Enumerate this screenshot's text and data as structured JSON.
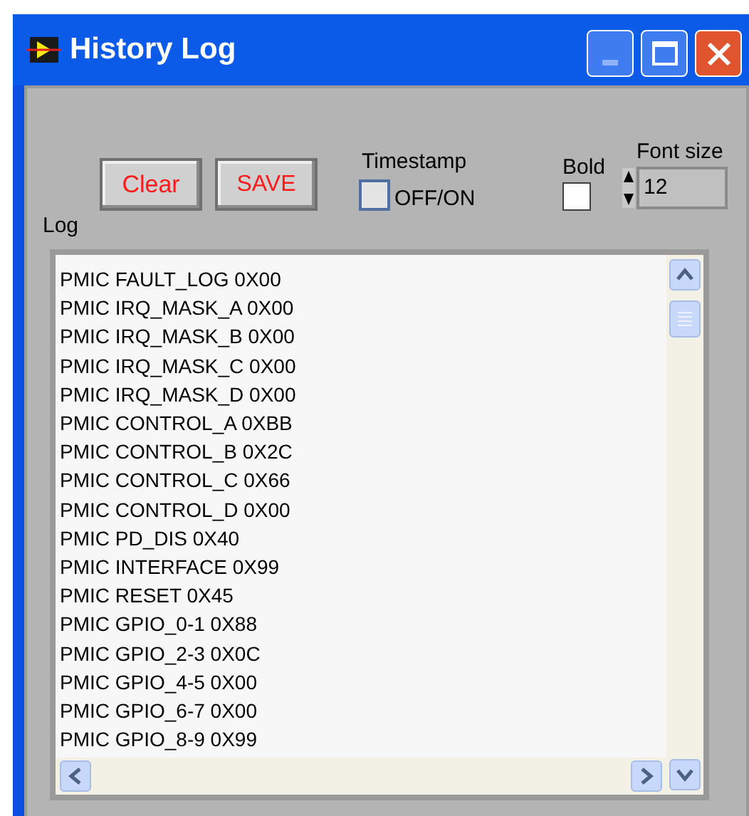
{
  "window": {
    "title": "History Log"
  },
  "buttons": [
    {
      "label": "Clear"
    },
    {
      "label": "SAVE"
    }
  ],
  "timestamp": {
    "label": "Timestamp",
    "option": "OFF/ON",
    "checked": false
  },
  "bold": {
    "label": "Bold",
    "checked": false
  },
  "font_size": {
    "label": "Font size",
    "value": "12"
  },
  "log": {
    "label": "Log",
    "lines": [
      "PMIC FAULT_LOG 0X00",
      "PMIC IRQ_MASK_A 0X00",
      "PMIC IRQ_MASK_B 0X00",
      "PMIC IRQ_MASK_C 0X00",
      "PMIC IRQ_MASK_D 0X00",
      "PMIC CONTROL_A 0XBB",
      "PMIC CONTROL_B 0X2C",
      "PMIC CONTROL_C 0X66",
      "PMIC CONTROL_D 0X00",
      "PMIC PD_DIS 0X40",
      "PMIC INTERFACE 0X99",
      "PMIC RESET 0X45",
      "PMIC GPIO_0-1 0X88",
      "PMIC GPIO_2-3 0X0C",
      "PMIC GPIO_4-5 0X00",
      "PMIC GPIO_6-7 0X00",
      "PMIC GPIO_8-9 0X99"
    ]
  }
}
